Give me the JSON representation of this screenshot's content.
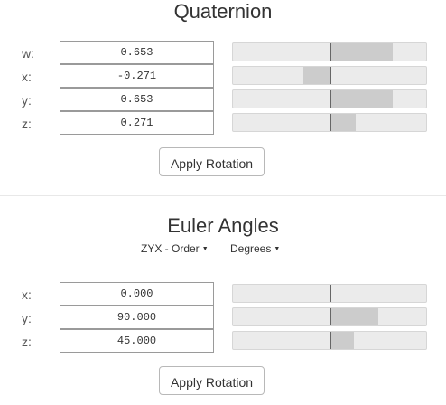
{
  "quaternion": {
    "title": "Quaternion",
    "rows": [
      {
        "label": "w:",
        "value": "0.653",
        "fraction": 0.653
      },
      {
        "label": "x:",
        "value": "-0.271",
        "fraction": -0.271
      },
      {
        "label": "y:",
        "value": "0.653",
        "fraction": 0.653
      },
      {
        "label": "z:",
        "value": "0.271",
        "fraction": 0.271
      }
    ],
    "apply_label": "Apply Rotation"
  },
  "euler": {
    "title": "Euler Angles",
    "order_label": "ZYX - Order",
    "unit_label": "Degrees",
    "rows": [
      {
        "label": "x:",
        "value": "0.000",
        "fraction": 0.0
      },
      {
        "label": "y:",
        "value": "90.000",
        "fraction": 0.5
      },
      {
        "label": "z:",
        "value": "45.000",
        "fraction": 0.25
      }
    ],
    "apply_label": "Apply Rotation"
  }
}
